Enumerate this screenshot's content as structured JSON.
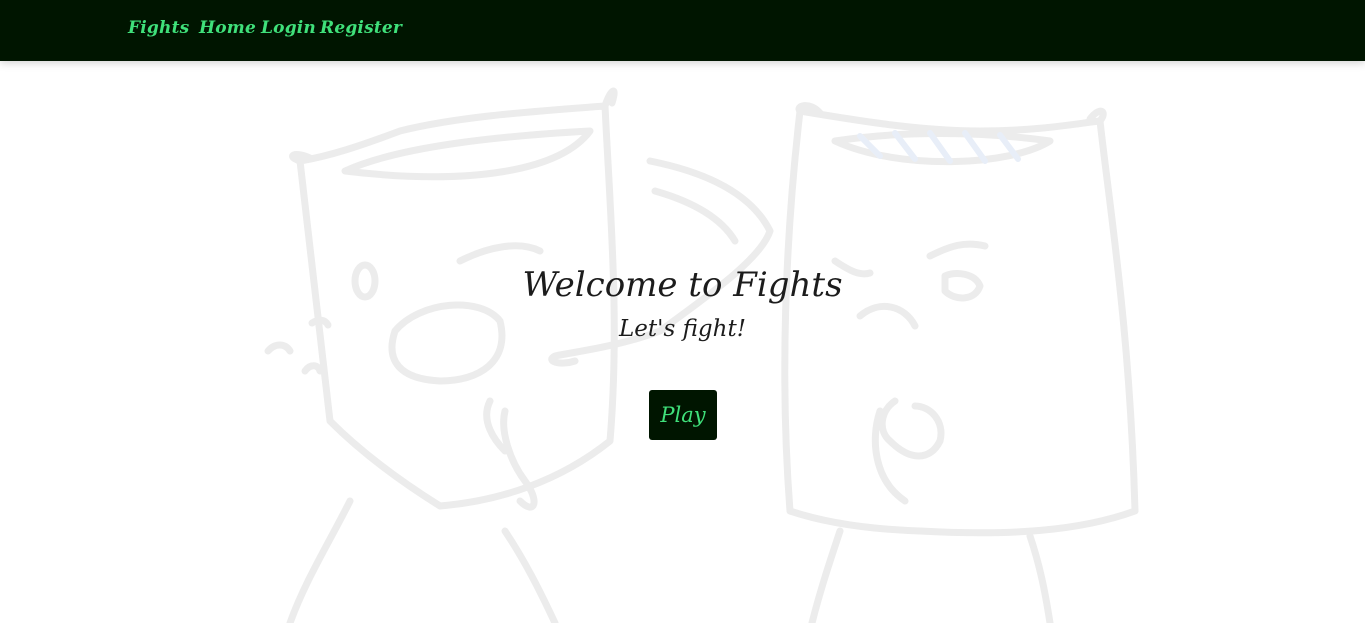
{
  "navbar": {
    "brand": "Fights",
    "links": [
      "Home",
      "Login",
      "Register"
    ]
  },
  "hero": {
    "title": "Welcome to Fights",
    "subtitle": "Let's fight!",
    "play_label": "Play"
  },
  "colors": {
    "nav_background": "#001500",
    "accent_green": "#3fe07a",
    "text_dark": "#1c1c1c",
    "art_stroke": "#ececec"
  },
  "background": {
    "icon": "pillow-fight-illustration"
  }
}
